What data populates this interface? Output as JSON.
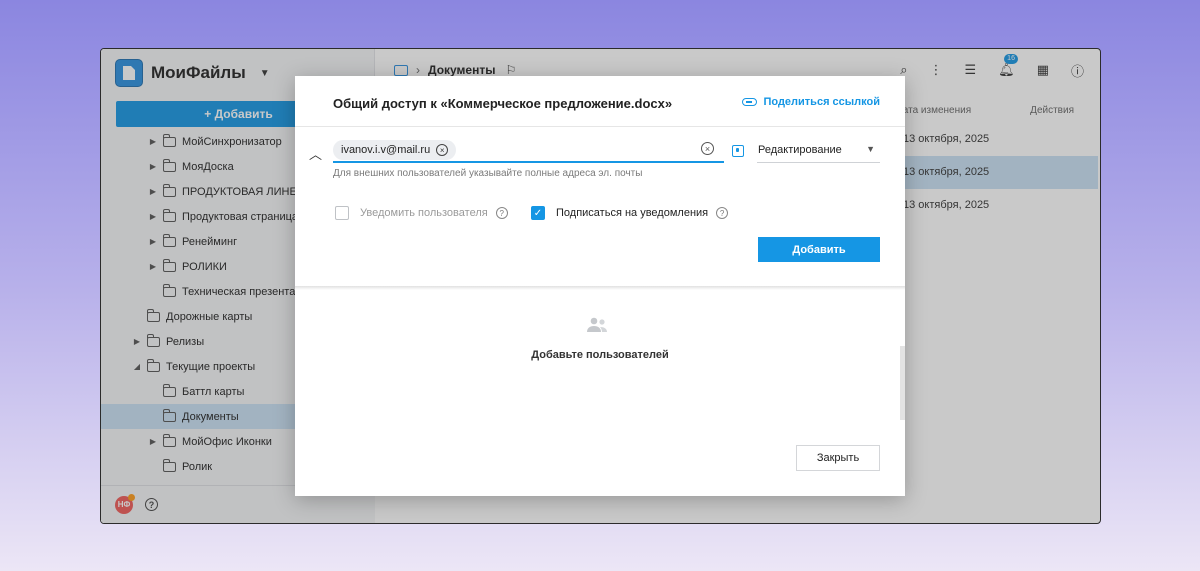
{
  "app": {
    "title": "МоиФайлы",
    "add_label": "+ Добавить"
  },
  "sidebar": {
    "items": [
      {
        "label": "МойСинхронизатор",
        "level": 2,
        "expandable": true
      },
      {
        "label": "МояДоска",
        "level": 2,
        "expandable": true
      },
      {
        "label": "ПРОДУКТОВАЯ ЛИНЕЙКА",
        "level": 2,
        "expandable": true
      },
      {
        "label": "Продуктовая страница сайта",
        "level": 2,
        "expandable": true
      },
      {
        "label": "Ренейминг",
        "level": 2,
        "expandable": true
      },
      {
        "label": "РОЛИКИ",
        "level": 2,
        "expandable": true
      },
      {
        "label": "Техническая презентация",
        "level": 2,
        "expandable": false
      },
      {
        "label": "Дорожные карты",
        "level": 1,
        "expandable": false
      },
      {
        "label": "Релизы",
        "level": 1,
        "expandable": true
      },
      {
        "label": "Текущие проекты",
        "level": 1,
        "expandable": true,
        "expanded": true
      },
      {
        "label": "Баттл карты",
        "level": 2,
        "expandable": false
      },
      {
        "label": "Документы",
        "level": 2,
        "expandable": false,
        "active": true
      },
      {
        "label": "МойОфис Иконки",
        "level": 2,
        "expandable": true
      },
      {
        "label": "Ролик",
        "level": 2,
        "expandable": false
      }
    ],
    "avatar_initials": "НФ"
  },
  "topbar": {
    "breadcrumb": "Документы",
    "notifications_count": "16"
  },
  "table": {
    "col_date": "Дата изменения",
    "col_actions": "Действия",
    "rows": [
      {
        "date": "13 октября, 2025"
      },
      {
        "date": "13 октября, 2025",
        "selected": true
      },
      {
        "date": "13 октября, 2025"
      }
    ]
  },
  "dialog": {
    "title": "Общий доступ к «Коммерческое предложение.docx»",
    "share_link_label": "Поделиться ссылкой",
    "email_chip": "ivanov.i.v@mail.ru",
    "role": "Редактирование",
    "hint": "Для внешних пользователей указывайте полные адреса эл. почты",
    "notify_label": "Уведомить пользователя",
    "notify_checked": false,
    "subscribe_label": "Подписаться на уведомления",
    "subscribe_checked": true,
    "add_button": "Добавить",
    "empty_text": "Добавьте пользователей",
    "close_button": "Закрыть"
  },
  "colors": {
    "accent": "#1596e4",
    "selected_row": "#c9e1f4"
  }
}
